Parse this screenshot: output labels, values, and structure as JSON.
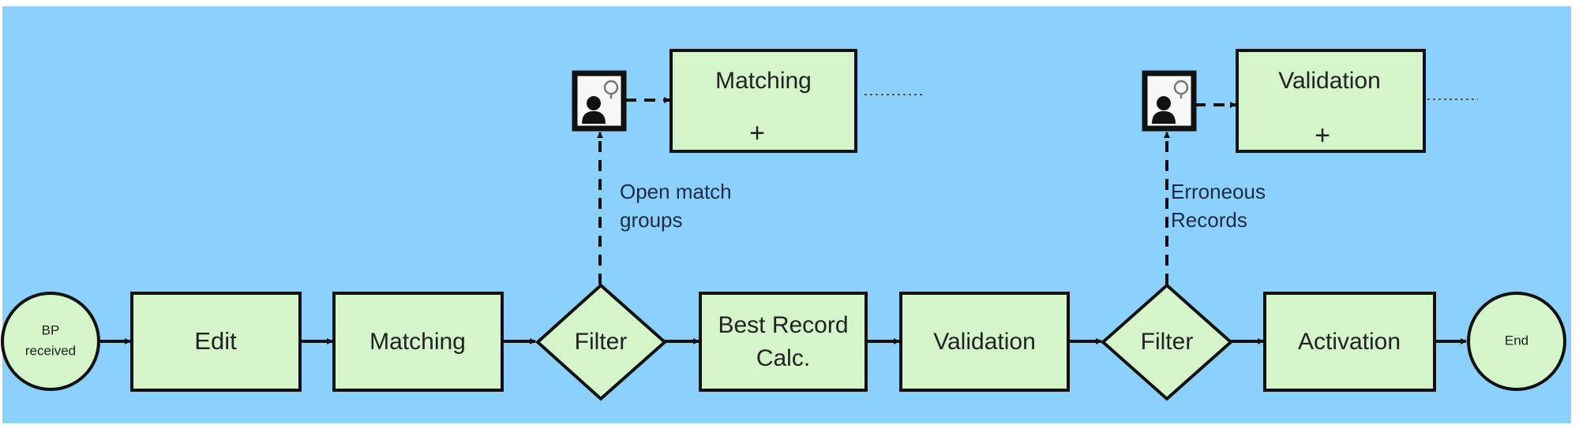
{
  "colors": {
    "background": "#8cd0fd",
    "shape_fill": "#d3f5c9",
    "stroke": "#111111"
  },
  "main_flow": {
    "start": "BP",
    "start_line2": "received",
    "edit": "Edit",
    "matching": "Matching",
    "filter1": "Filter",
    "best_record_line1": "Best Record",
    "best_record_line2": "Calc.",
    "validation": "Validation",
    "filter2": "Filter",
    "activation": "Activation",
    "end": "End"
  },
  "branches": [
    {
      "icon": "user-task-icon",
      "subprocess": "Matching",
      "marker": "+",
      "condition_line1": "Open match",
      "condition_line2": "groups"
    },
    {
      "icon": "user-task-icon",
      "subprocess": "Validation",
      "marker": "+",
      "condition_line1": "Erroneous",
      "condition_line2": "Records"
    }
  ]
}
